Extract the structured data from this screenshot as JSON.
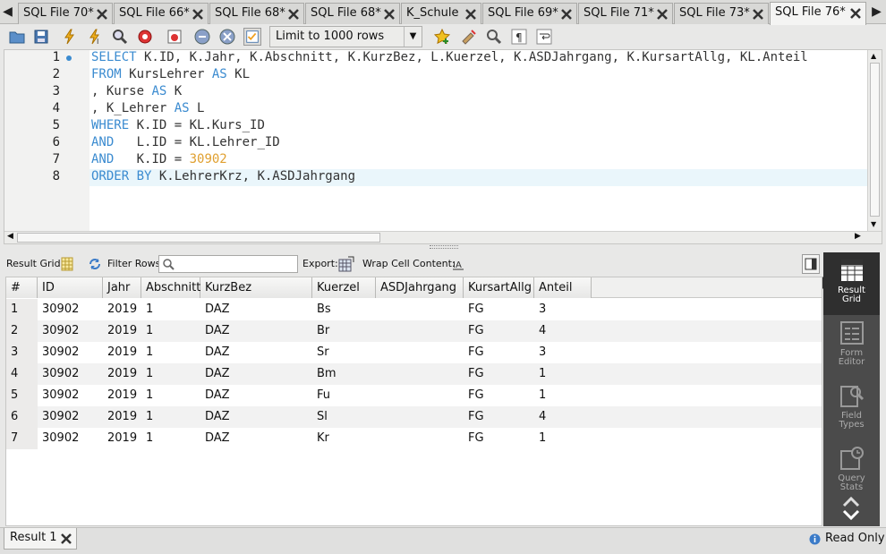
{
  "tabs": [
    {
      "label": "SQL File 70*"
    },
    {
      "label": "SQL File 66*"
    },
    {
      "label": "SQL File 68*"
    },
    {
      "label": "SQL File 68*"
    },
    {
      "label": "K_Schule"
    },
    {
      "label": "SQL File 69*"
    },
    {
      "label": "SQL File 71*"
    },
    {
      "label": "SQL File 73*"
    },
    {
      "label": "SQL File 76*"
    }
  ],
  "toolbar": {
    "limit_label": "Limit to 1000 rows"
  },
  "editor": {
    "line_numbers": [
      "1",
      "2",
      "3",
      "4",
      "5",
      "6",
      "7",
      "8"
    ],
    "lines": [
      {
        "kw": "SELECT",
        "rest": " K.ID, K.Jahr, K.Abschnitt, K.KurzBez, L.Kuerzel, K.ASDJahrgang, K.KursartAllg, KL.Anteil"
      },
      {
        "kw": "FROM",
        "rest": " KursLehrer ",
        "kw2": "AS",
        "rest2": " KL"
      },
      {
        "pre": ", Kurse ",
        "kw": "AS",
        "rest": " K"
      },
      {
        "pre": ", K_Lehrer ",
        "kw": "AS",
        "rest": " L"
      },
      {
        "kw": "WHERE",
        "rest": " K.ID = KL.Kurs_ID"
      },
      {
        "kw": "AND",
        "rest": "   L.ID = KL.Lehrer_ID"
      },
      {
        "kw": "AND",
        "rest": "   K.ID = ",
        "num": "30902"
      },
      {
        "kw": "ORDER BY",
        "rest": " K.LehrerKrz, K.ASDJahrgang"
      }
    ]
  },
  "result_toolbar": {
    "result_grid": "Result Grid",
    "filter_rows": "Filter Rows:",
    "export": "Export:",
    "wrap": "Wrap Cell Content:"
  },
  "grid": {
    "columns": [
      "#",
      "ID",
      "Jahr",
      "Abschnitt",
      "KurzBez",
      "Kuerzel",
      "ASDJahrgang",
      "KursartAllg",
      "Anteil"
    ],
    "rows": [
      [
        "1",
        "30902",
        "2019",
        "1",
        "DAZ",
        "Bs",
        "",
        "FG",
        "3"
      ],
      [
        "2",
        "30902",
        "2019",
        "1",
        "DAZ",
        "Br",
        "",
        "FG",
        "4"
      ],
      [
        "3",
        "30902",
        "2019",
        "1",
        "DAZ",
        "Sr",
        "",
        "FG",
        "3"
      ],
      [
        "4",
        "30902",
        "2019",
        "1",
        "DAZ",
        "Bm",
        "",
        "FG",
        "1"
      ],
      [
        "5",
        "30902",
        "2019",
        "1",
        "DAZ",
        "Fu",
        "",
        "FG",
        "1"
      ],
      [
        "6",
        "30902",
        "2019",
        "1",
        "DAZ",
        "Sl",
        "",
        "FG",
        "4"
      ],
      [
        "7",
        "30902",
        "2019",
        "1",
        "DAZ",
        "Kr",
        "",
        "FG",
        "1"
      ]
    ]
  },
  "side_panel": [
    {
      "line1": "Result",
      "line2": "Grid"
    },
    {
      "line1": "Form",
      "line2": "Editor"
    },
    {
      "line1": "Field",
      "line2": "Types"
    },
    {
      "line1": "Query",
      "line2": "Stats"
    }
  ],
  "bottom": {
    "result_tab": "Result 1",
    "status": "Read Only"
  }
}
